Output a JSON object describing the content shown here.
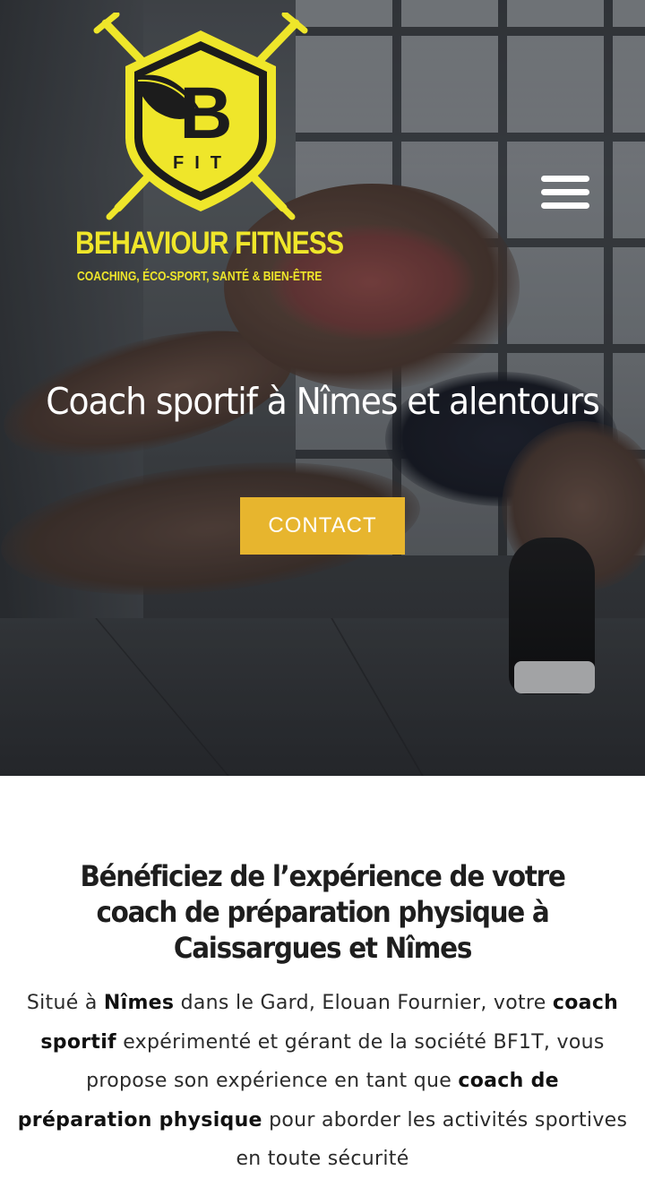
{
  "brand": {
    "logo_letter": "B",
    "logo_sub": "FIT",
    "name": "BEHAVIOUR FITNESS",
    "tagline": "COACHING, ÉCO-SPORT, SANTÉ & BIEN-ÊTRE",
    "accent_color": "#efe62a"
  },
  "header": {
    "menu_icon": "hamburger-menu-icon"
  },
  "hero": {
    "title": "Coach sportif à Nîmes et alentours",
    "contact_label": "CONTACT",
    "button_color": "#e7b52e"
  },
  "section": {
    "title": "Bénéficiez de l’expérience de votre coach de préparation physique à Caissargues et Nîmes",
    "intro": {
      "t1": "Situé à ",
      "b1": "Nîmes",
      "t2": " dans le Gard, Elouan Fournier, votre ",
      "b2": "coach sportif",
      "t3": " expérimenté et gérant de la société BF1T, vous propose son expérience en tant que ",
      "b3": "coach de préparation physique",
      "t4": " pour aborder les activités sportives en toute sécurité"
    }
  }
}
